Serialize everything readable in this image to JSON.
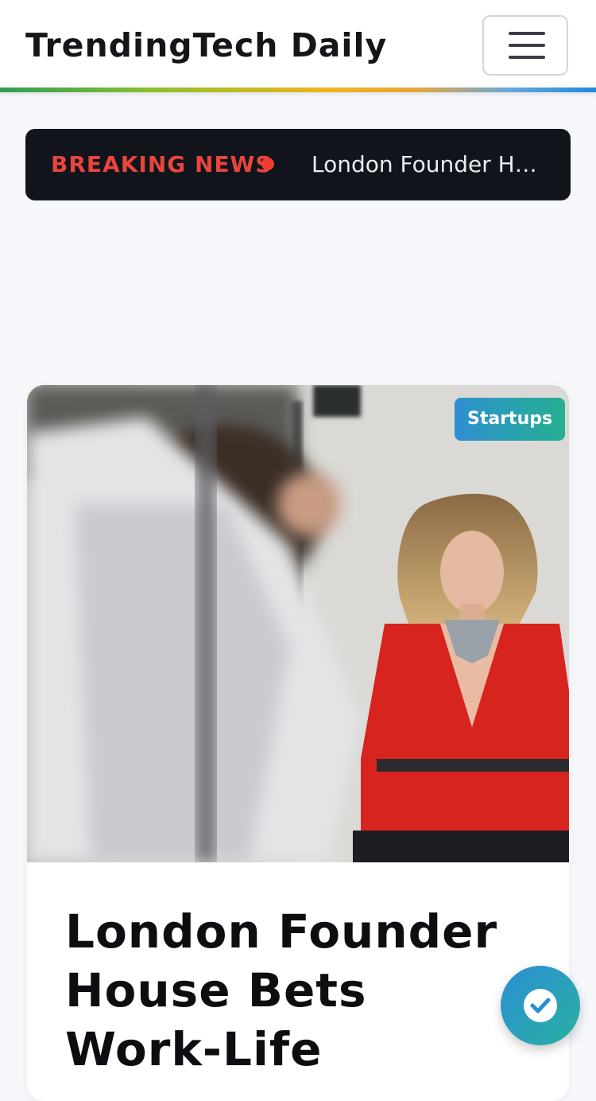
{
  "header": {
    "brand": "TrendingTech Daily",
    "menu_icon": "hamburger-menu-icon"
  },
  "ticker": {
    "label": "BREAKING NEWS",
    "headline": "London Founder House Bets Work-Life",
    "dot_color": "#ef3b32"
  },
  "article": {
    "category": "Startups",
    "title": "London Founder House Bets Work-Life"
  },
  "fab": {
    "icon": "check-circle-icon"
  },
  "colors": {
    "accent_red": "#e8453c",
    "badge_gradient_start": "#2e8fd2",
    "badge_gradient_end": "#24b08f",
    "ticker_bg": "#11141b"
  }
}
